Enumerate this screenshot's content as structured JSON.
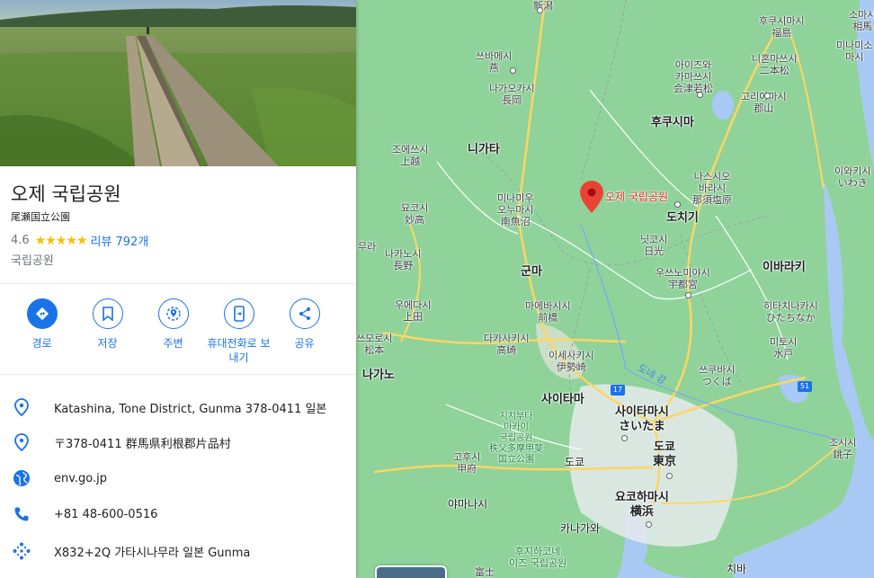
{
  "place": {
    "name": "오제 국립공원",
    "native_name": "尾瀬国立公園",
    "rating": "4.6",
    "stars": "★★★★★",
    "reviews": "리뷰 792개",
    "category": "국립공원"
  },
  "actions": [
    {
      "label": "경로",
      "icon": "directions-icon"
    },
    {
      "label": "저장",
      "icon": "bookmark-icon"
    },
    {
      "label": "주변",
      "icon": "nearby-icon"
    },
    {
      "label": "휴대전화로 보내기",
      "icon": "send-to-phone-icon"
    },
    {
      "label": "공유",
      "icon": "share-icon"
    }
  ],
  "info": {
    "address": "Katashina, Tone District, Gunma 378-0411 일본",
    "address_ja": "〒378-0411 群馬県利根郡片品村",
    "website": "env.go.jp",
    "phone": "+81 48-600-0516",
    "plus_code": "X832+2Q 가타시나무라 일본 Gunma"
  },
  "colors": {
    "accent": "#1a73e8",
    "pin": "#ea4335",
    "stars": "#fbbc04",
    "land": "#8fd39a",
    "water": "#a9c9f5"
  },
  "map": {
    "pin_label": "오제 국립공원",
    "labels": {
      "niigata_city": "니가타",
      "niigata_city_ja": "新潟",
      "sanjo": "쓰바메시\n燕",
      "nagaoka": "나가오카시\n長岡",
      "aizu": "아이즈와\n카마쓰시\n会津若松",
      "koriyama": "고리야마시\n郡山",
      "fukushima": "후쿠시마시\n福島",
      "nihonmatsu": "니혼마쓰시\n二本松",
      "soma": "소마시\n相馬",
      "minamisoma": "미나미소\n마시",
      "fukushima_pref": "후쿠시마",
      "niigata_pref": "니가타",
      "joetsu": "조에쓰시\n上越",
      "myoko": "묘코시\n妙高",
      "minamiuonuma": "미나미우\n오누마시\n南魚沼",
      "nasushiobara": "나스시오\n바라시\n那須塩原",
      "tochigi_pref": "도치기",
      "iwaki": "이와키시\nいわき",
      "nikko": "닛코시\n日光",
      "utsunomiya": "우쓰노미야시\n宇都宮",
      "ibaraki_pref": "이바라키",
      "nagano_left": "무라",
      "nakano": "나카노시\n長野",
      "gunma_pref": "군마",
      "ueda": "우에다시\n上田",
      "maebashi": "마에바시시\n前橋",
      "komoro": "쓰모로시\n松本",
      "takasaki": "다카사키시\n高崎",
      "isesaki": "이세사키시\n伊勢崎",
      "hitachinaka": "히타치나카시\nひたちなか",
      "mito": "미토시\n水戸",
      "nagano_pref": "나가노",
      "tone_river": "도네 강",
      "tsukuba": "쓰쿠바시\nつくば",
      "saitama_pref": "사이타마",
      "saitama_city": "사이타마시\nさいたま",
      "chichibu": "지치부타\n마카이\n국립공원\n秩父多摩甲斐\n国立公園",
      "kofu": "고후시\n甲府",
      "tokyo_pref": "도쿄",
      "tokyo": "도쿄\n東京",
      "choshi": "조시시\n銚子",
      "yamanashi": "야마나시",
      "yokohama": "요코하마시\n横浜",
      "kanagawa": "카나가와",
      "fuji": "후지하코네\n이즈 국립공원",
      "fuji2": "富士",
      "chiba": "치바",
      "route17": "17",
      "route51": "51"
    }
  }
}
